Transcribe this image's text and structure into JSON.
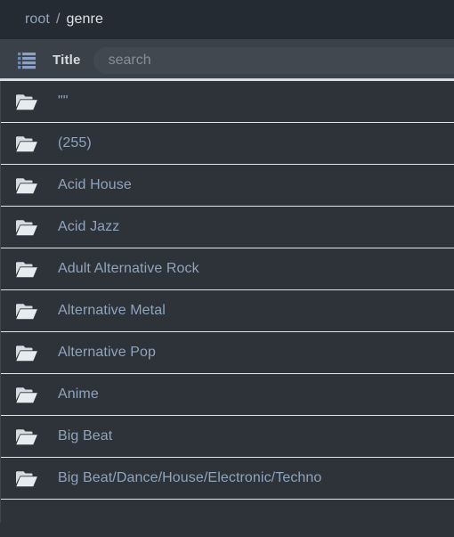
{
  "breadcrumb": {
    "root_label": "root",
    "separator": "/",
    "current_label": "genre"
  },
  "toolbar": {
    "view_icon": "list-view-icon",
    "title_label": "Title",
    "search_placeholder": "search",
    "search_value": ""
  },
  "colors": {
    "top_bar_bg": "#252b33",
    "toolbar_bg": "#3b4148",
    "list_bg": "#2d3339",
    "row_separator": "#e2e6ea",
    "link_text": "#8fa4bd",
    "current_crumb_text": "#dfe3e8",
    "title_text": "#d7dbe0",
    "placeholder_text": "#868e98",
    "folder_icon": "#d7dbdf",
    "view_icon_accent": "#6f88b8"
  },
  "list": {
    "icon": "folder-icon",
    "rows": [
      {
        "label": "\"\""
      },
      {
        "label": "(255)"
      },
      {
        "label": "Acid House"
      },
      {
        "label": "Acid Jazz"
      },
      {
        "label": "Adult Alternative Rock"
      },
      {
        "label": "Alternative Metal"
      },
      {
        "label": "Alternative Pop"
      },
      {
        "label": "Anime"
      },
      {
        "label": "Big Beat"
      },
      {
        "label": "Big Beat/Dance/House/Electronic/Techno"
      }
    ]
  }
}
